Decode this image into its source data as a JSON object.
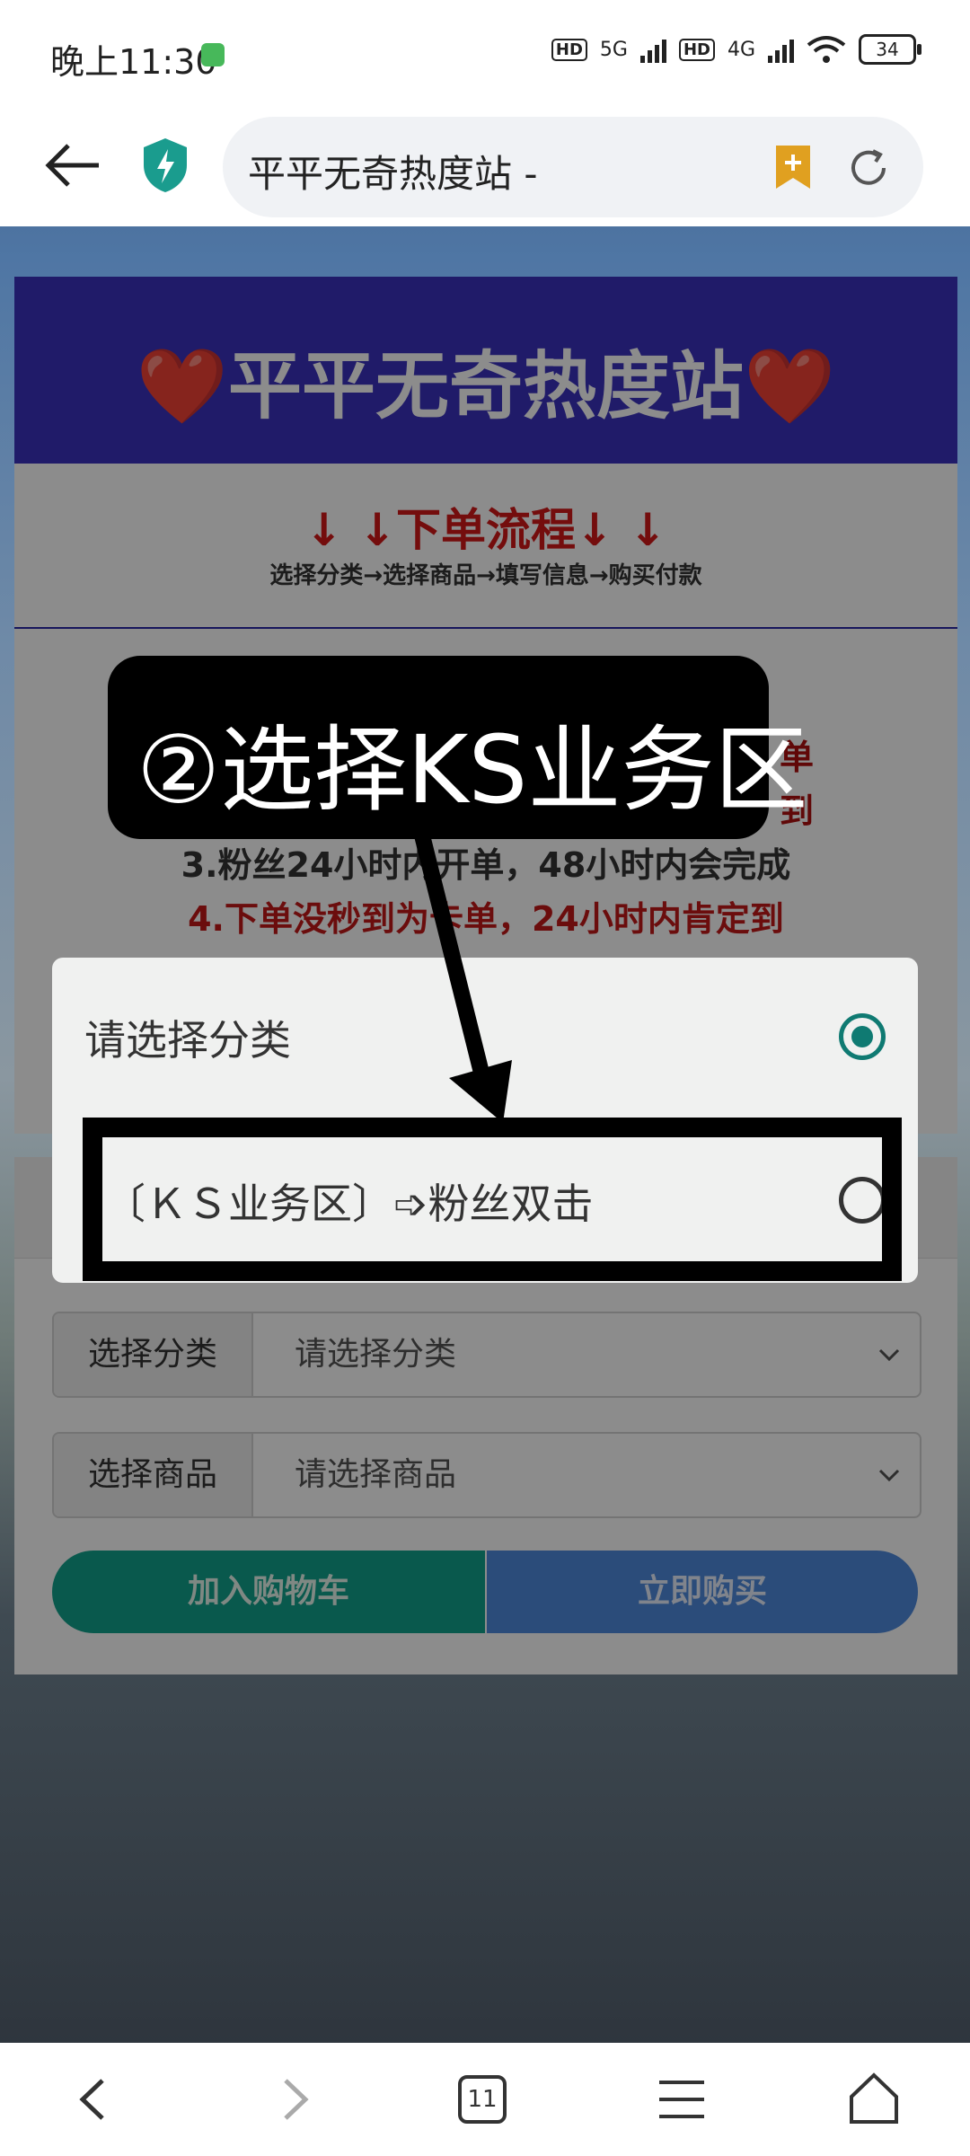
{
  "status_bar": {
    "time": "晚上11:30",
    "network_1": "5G",
    "network_2": "4G",
    "hd": "HD",
    "battery": "34"
  },
  "browser": {
    "url_title": "平平无奇热度站 -"
  },
  "page": {
    "hero_title": "❤️平平无奇热度站❤️",
    "process_title": "↓ ↓下单流程↓ ↓",
    "process_steps": "选择分类→选择商品→填写信息→购买付款",
    "notes": [
      "单",
      "到",
      "3.粉丝24小时内开单，48小时内会完成",
      "4.下单没秒到为卡单，24小时内肯定到"
    ],
    "form": {
      "category_label": "选择分类",
      "category_value": "请选择分类",
      "product_label": "选择商品",
      "product_value": "请选择商品",
      "cart_button": "加入购物车",
      "buy_button": "立即购买"
    }
  },
  "dialog": {
    "options": [
      {
        "label": "请选择分类",
        "selected": true
      },
      {
        "label": "〔ＫＳ业务区〕➩粉丝双击",
        "selected": false
      }
    ]
  },
  "annotation": {
    "text": "②选择KS业务区"
  },
  "bottom_nav": {
    "tabs_count": "11"
  },
  "colors": {
    "hero_bg": "#3b32c0",
    "process_red": "#d31818",
    "radio_accent": "#0f7a72",
    "cart_green": "#12a28c",
    "buy_blue": "#4f8bde"
  }
}
